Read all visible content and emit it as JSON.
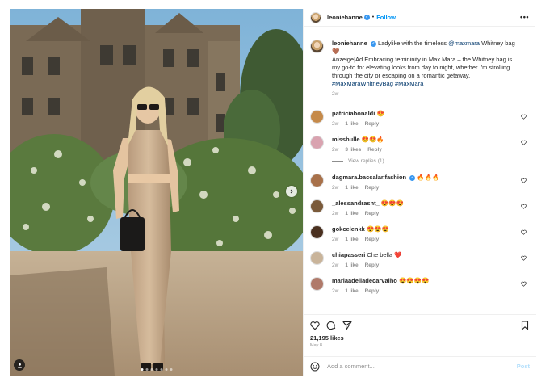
{
  "post": {
    "author": "leoniehanne",
    "follow_label": "Follow",
    "separator": "•",
    "more_label": "•••",
    "caption": {
      "username": "leoniehanne",
      "text_1": "Ladylike with the timeless",
      "mention": "@maxmara",
      "text_2": "Whitney bag 🤎",
      "body": "Anzeige|Ad Embracing femininity in Max Mara – the Whitney bag is my go-to for elevating looks from day to night, whether I'm strolling through the city or escaping on a romantic getaway.",
      "hashtags": "#MaxMaraWhitneyBag #MaxMara",
      "age": "2w"
    },
    "comments": [
      {
        "username": "patriciabonaldi",
        "text": "😍",
        "age": "2w",
        "likes": "1 like",
        "reply": "Reply",
        "avatar_color": "#c58a4a"
      },
      {
        "username": "misshulle",
        "text": "😍😍🔥",
        "age": "2w",
        "likes": "3 likes",
        "reply": "Reply",
        "avatar_color": "#d9a3b0"
      },
      {
        "username": "dagmara.baccalar.fashion",
        "text": "🔥🔥🔥",
        "age": "2w",
        "likes": "1 like",
        "reply": "Reply",
        "avatar_color": "#a8714a",
        "verified": true
      },
      {
        "username": "_alessandrasnt_",
        "text": "😍😍😍",
        "age": "2w",
        "likes": "1 like",
        "reply": "Reply",
        "avatar_color": "#7a5a3a"
      },
      {
        "username": "gokcelenkk",
        "text": "😍😍😍",
        "age": "2w",
        "likes": "1 like",
        "reply": "Reply",
        "avatar_color": "#4a3020"
      },
      {
        "username": "chiapasseri",
        "text": "Che bella ❤️",
        "age": "2w",
        "likes": "1 like",
        "reply": "Reply",
        "avatar_color": "#c9b49a"
      },
      {
        "username": "mariaadeliadecarvalho",
        "text": "😍😍😍😍",
        "age": "2w",
        "likes": "1 like",
        "reply": "Reply",
        "avatar_color": "#b07a6a"
      }
    ],
    "view_replies": "View replies (1)",
    "likes_count": "21,195 likes",
    "date": "May 8",
    "add_comment_placeholder": "Add a comment...",
    "post_button": "Post",
    "icons": {
      "like": "heart-icon",
      "comment": "comment-icon",
      "share": "share-icon",
      "save": "bookmark-icon",
      "emoji": "emoji-icon",
      "next": "chevron-right-icon",
      "tag": "user-tag-icon"
    },
    "colors": {
      "accent": "#0095f6",
      "link": "#00376b",
      "muted": "#8e8e8e",
      "verified": "#3897f0"
    }
  }
}
